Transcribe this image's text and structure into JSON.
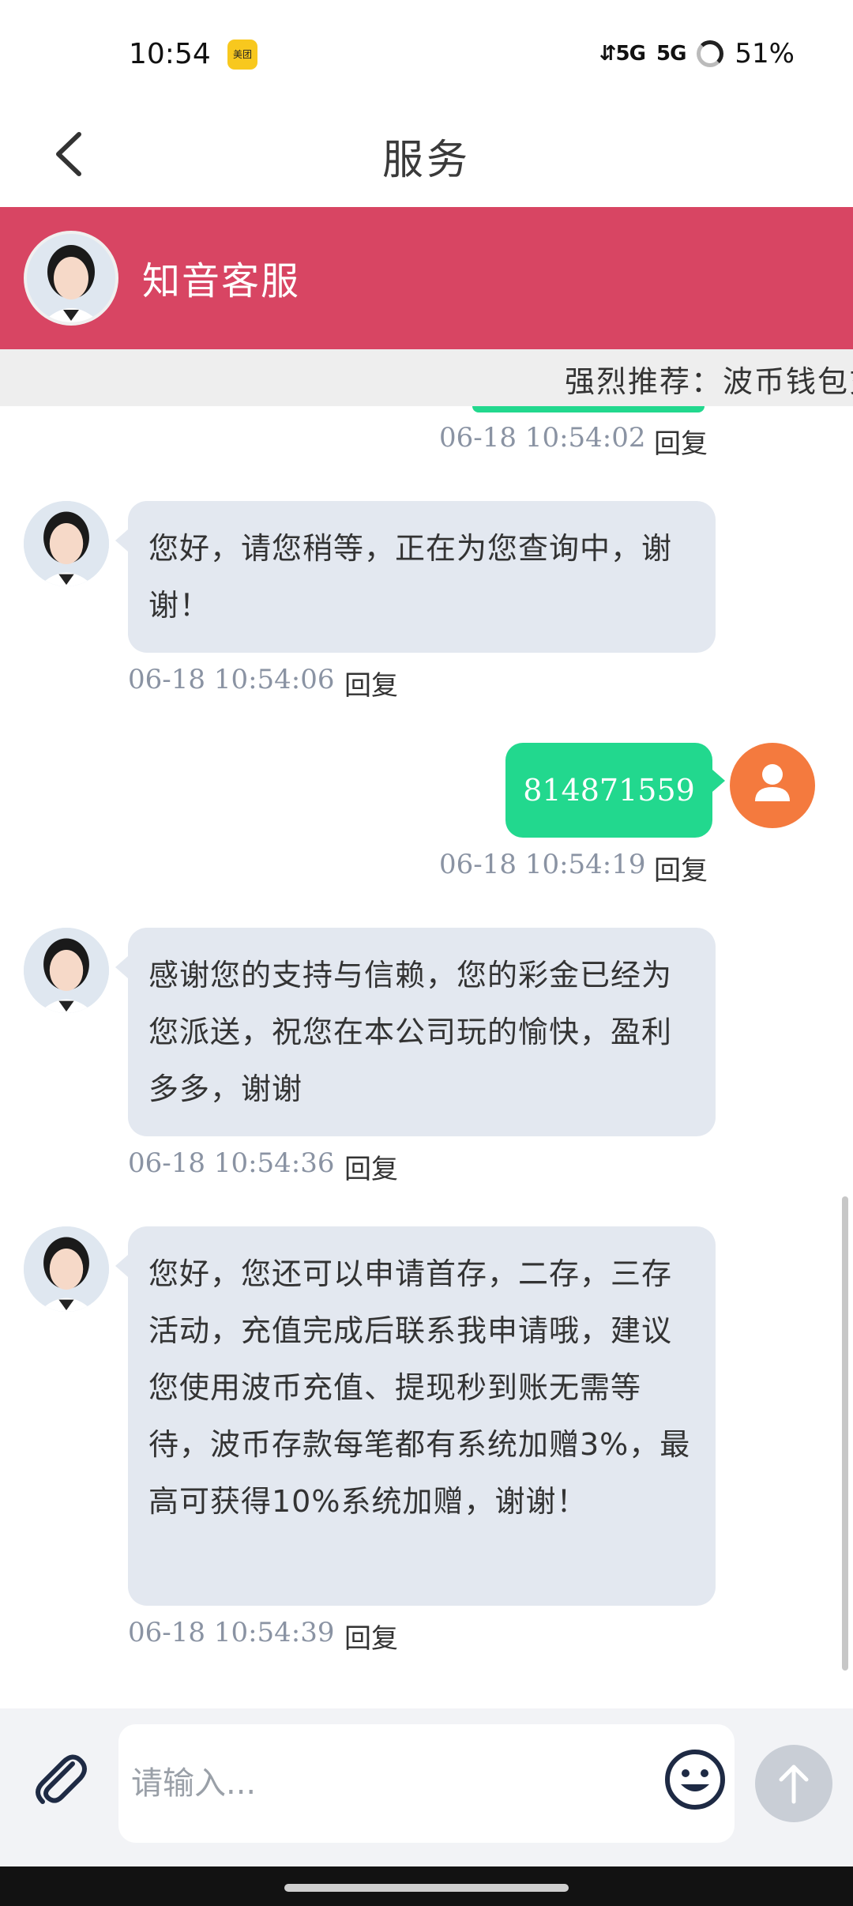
{
  "status_bar": {
    "time": "10:54",
    "app_badge": "美团",
    "signal_1": "⇵5G",
    "signal_2": "5G",
    "battery": "51%"
  },
  "header": {
    "title": "服务"
  },
  "service": {
    "name": "知音客服"
  },
  "marquee": {
    "text": "强烈推荐：波币钱包充"
  },
  "chat": {
    "messages": [
      {
        "side": "right",
        "time": "06-18 10:54:02",
        "reply": "回复"
      },
      {
        "side": "left",
        "text": "您好，请您稍等，正在为您查询中，谢谢！",
        "time": "06-18 10:54:06",
        "reply": "回复"
      },
      {
        "side": "right",
        "text": "814871559",
        "time": "06-18 10:54:19",
        "reply": "回复"
      },
      {
        "side": "left",
        "text": "感谢您的支持与信赖，您的彩金已经为您派送，祝您在本公司玩的愉快，盈利多多，谢谢",
        "time": "06-18 10:54:36",
        "reply": "回复"
      },
      {
        "side": "left",
        "text": "您好，您还可以申请首存，二存，三存活动，充值完成后联系我申请哦，建议您使用波币充值、提现秒到账无需等待，波币存款每笔都有系统加赠3%，最高可获得10%系统加赠，谢谢！",
        "time": "06-18 10:54:39",
        "reply": "回复"
      }
    ]
  },
  "input": {
    "placeholder": "请输入..."
  },
  "colors": {
    "brand": "#d84563",
    "user_bubble": "#22d88e",
    "agent_bubble": "#e3e8f0",
    "user_avatar": "#f47a3e"
  }
}
